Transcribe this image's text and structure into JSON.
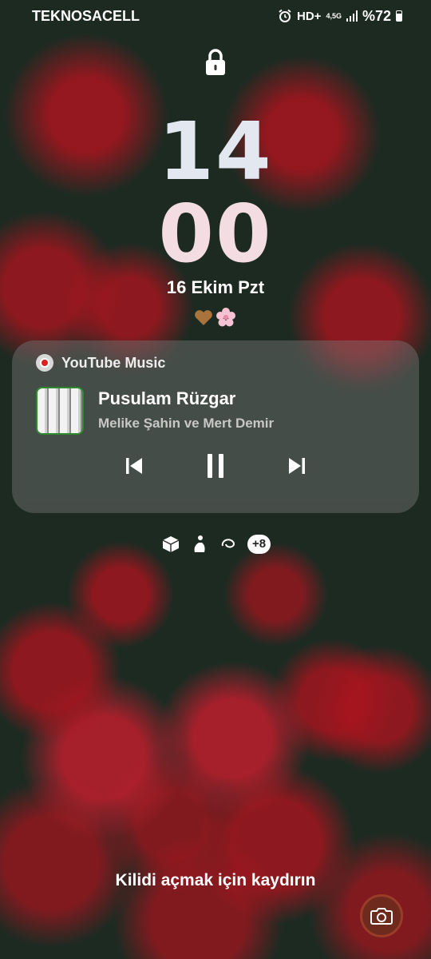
{
  "status_bar": {
    "carrier": "TEKNOSACELL",
    "network": "HD+",
    "network_type": "4,5G",
    "battery_percent": "%72",
    "icons": [
      "alarm-icon",
      "signal-icon",
      "battery-icon"
    ]
  },
  "lock": {
    "icon": "lock-icon"
  },
  "clock": {
    "hours": "14",
    "minutes": "00",
    "date": "16 Ekim Pzt"
  },
  "emoji": [
    "heart-icon",
    "flower-icon"
  ],
  "media": {
    "app_name": "YouTube Music",
    "title": "Pusulam Rüzgar",
    "artist": "Melike Şahin ve Mert Demir",
    "controls": [
      "previous-icon",
      "pause-icon",
      "next-icon"
    ]
  },
  "notifications": {
    "icons": [
      "box-icon",
      "figure-icon",
      "swirl-icon"
    ],
    "more": "+8"
  },
  "unlock_hint": "Kilidi açmak için kaydırın",
  "camera": {
    "icon": "camera-icon"
  }
}
